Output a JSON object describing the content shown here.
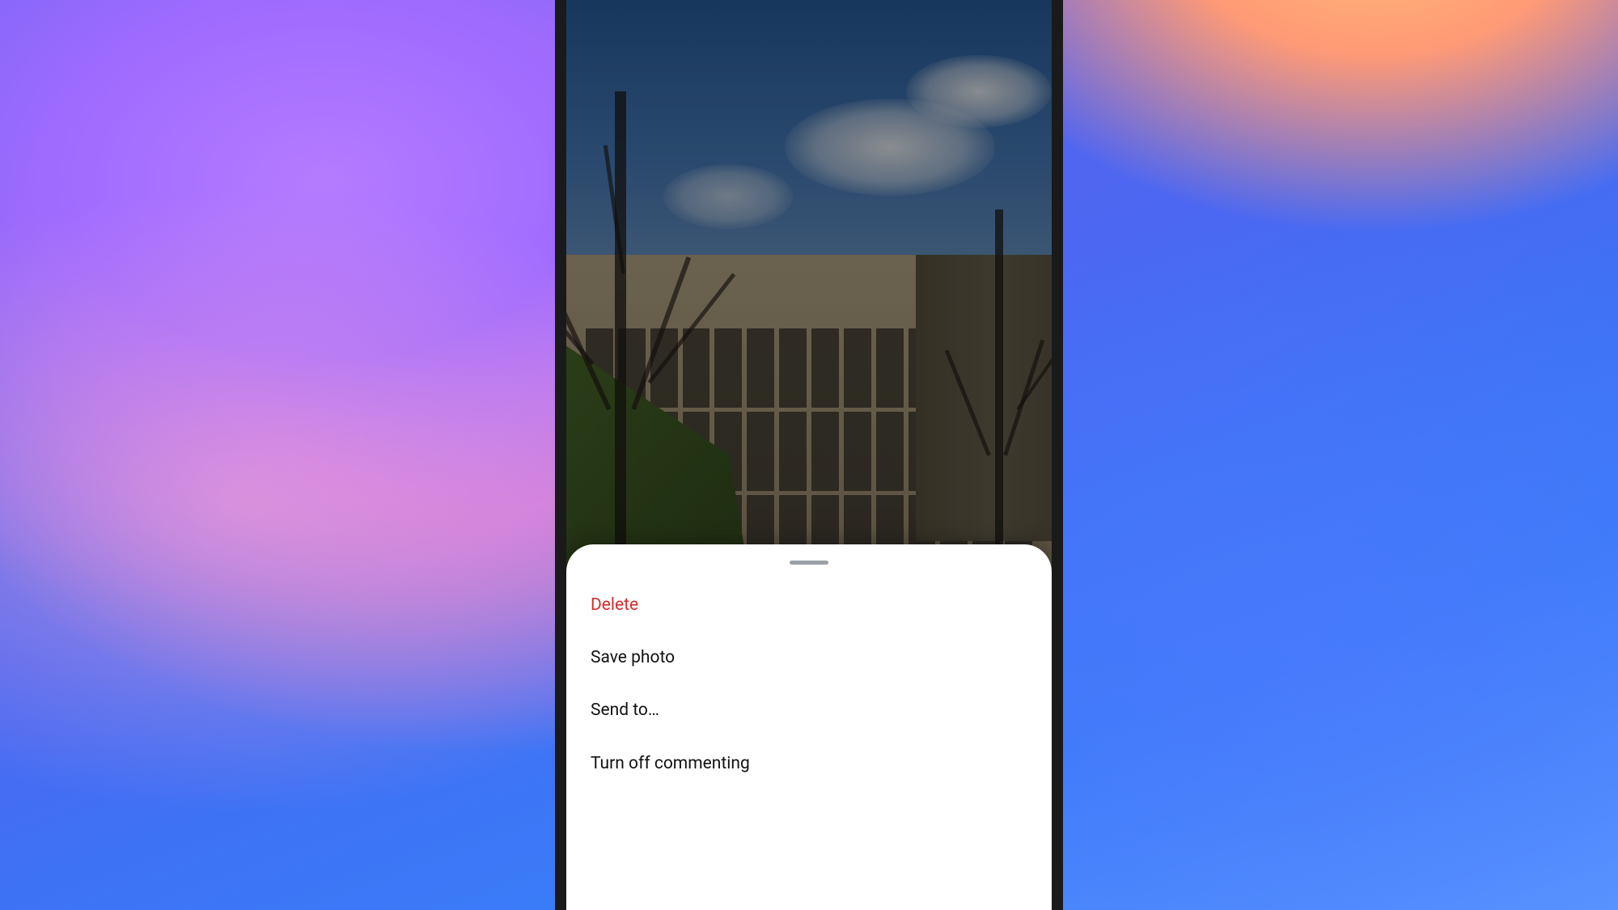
{
  "sheet": {
    "items": [
      {
        "label": "Delete",
        "style": "danger"
      },
      {
        "label": "Save photo",
        "style": "normal"
      },
      {
        "label": "Send to…",
        "style": "normal"
      },
      {
        "label": "Turn off commenting",
        "style": "normal"
      }
    ]
  }
}
